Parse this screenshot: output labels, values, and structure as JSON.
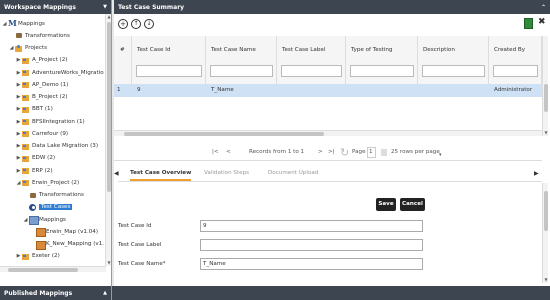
{
  "left_panel": {
    "title": "Workspace Mappings",
    "tree": [
      {
        "label": "Mappings",
        "icon": "root-icon",
        "toggle": "◢",
        "indent": 0
      },
      {
        "label": "Transformations",
        "icon": "transformations-icon",
        "toggle": "",
        "indent": 1
      },
      {
        "label": "Projects",
        "icon": "projects-icon",
        "toggle": "◢",
        "indent": 1
      },
      {
        "label": "A_Project (2)",
        "icon": "project-folder-icon",
        "toggle": "▶",
        "indent": 2
      },
      {
        "label": "AdventureWorks_Migration (",
        "icon": "project-folder-icon",
        "toggle": "▶",
        "indent": 2
      },
      {
        "label": "AP_Demo (1)",
        "icon": "project-folder-icon",
        "toggle": "▶",
        "indent": 2
      },
      {
        "label": "B_Project (2)",
        "icon": "project-folder-icon",
        "toggle": "▶",
        "indent": 2
      },
      {
        "label": "BBT (1)",
        "icon": "project-folder-icon",
        "toggle": "▶",
        "indent": 2
      },
      {
        "label": "BFSIIntegration (1)",
        "icon": "project-folder-icon",
        "toggle": "▶",
        "indent": 2
      },
      {
        "label": "Carrefour (9)",
        "icon": "project-folder-icon",
        "toggle": "▶",
        "indent": 2
      },
      {
        "label": "Data Lake Migration (3)",
        "icon": "project-folder-icon",
        "toggle": "▶",
        "indent": 2
      },
      {
        "label": "EDW (2)",
        "icon": "project-folder-icon",
        "toggle": "▶",
        "indent": 2
      },
      {
        "label": "ERP (2)",
        "icon": "project-folder-icon",
        "toggle": "▶",
        "indent": 2
      },
      {
        "label": "Erwin_Project (2)",
        "icon": "project-folder-icon",
        "toggle": "◢",
        "indent": 2
      },
      {
        "label": "Transformations",
        "icon": "transformations-icon",
        "toggle": "",
        "indent": 3
      },
      {
        "label": "Test Cases",
        "icon": "test-cases-icon",
        "toggle": "",
        "indent": 3,
        "selected": true
      },
      {
        "label": "Mappings",
        "icon": "mappings-folder-icon",
        "toggle": "◢",
        "indent": 3
      },
      {
        "label": "Erwin_Map (v1.04)",
        "icon": "mapping-icon",
        "toggle": "",
        "indent": 4
      },
      {
        "label": "K_New_Mapping (v1.",
        "icon": "mapping-icon",
        "toggle": "",
        "indent": 4
      },
      {
        "label": "Exeter (2)",
        "icon": "project-folder-icon",
        "toggle": "▶",
        "indent": 2
      }
    ],
    "bottom_title": "Published Mappings"
  },
  "summary": {
    "title": "Test Case Summary",
    "columns": [
      "#",
      "Test Case Id",
      "Test Case Name",
      "Test Case Label",
      "Type of Testing",
      "Description",
      "Created By"
    ],
    "rows": [
      {
        "num": "1",
        "id": "9",
        "name": "T_Name",
        "label": "",
        "type": "",
        "description": "",
        "created_by": "Administrator"
      }
    ],
    "pager": {
      "first": "|<",
      "prev": "<",
      "records": "Records from 1 to 1",
      "next": ">",
      "last": ">|",
      "page_label": "Page",
      "page_value": "1",
      "rows_per_page": "25 rows per page"
    }
  },
  "detail": {
    "tabs": [
      "Test Case Overview",
      "Validation Steps",
      "Document Upload"
    ],
    "save_label": "Save",
    "cancel_label": "Cancel",
    "fields": [
      {
        "label": "Test Case Id",
        "value": "9"
      },
      {
        "label": "Test Case Label",
        "value": ""
      },
      {
        "label": "Test Case Name*",
        "value": "T_Name"
      }
    ]
  },
  "colors": {
    "header_bg": "#3d4550",
    "selected_row": "#cfe2f5",
    "tree_selected": "#2d7dd2",
    "active_tab_underline": "#f0a030"
  }
}
